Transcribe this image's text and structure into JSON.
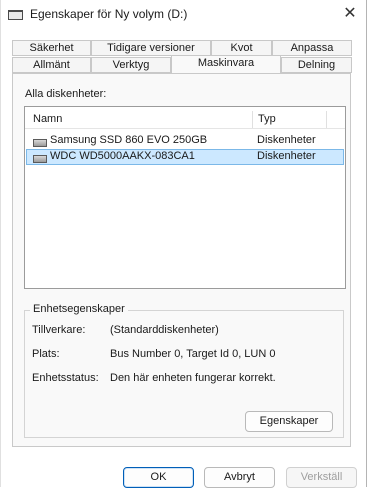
{
  "window": {
    "title": "Egenskaper för Ny volym (D:)"
  },
  "tabs_back": [
    {
      "label": "Säkerhet"
    },
    {
      "label": "Tidigare versioner"
    },
    {
      "label": "Kvot"
    },
    {
      "label": "Anpassa"
    }
  ],
  "tabs_front": [
    {
      "label": "Allmänt"
    },
    {
      "label": "Verktyg"
    },
    {
      "label": "Maskinvara"
    },
    {
      "label": "Delning"
    }
  ],
  "active_tab": "Maskinvara",
  "disks": {
    "label": "Alla diskenheter:",
    "columns": {
      "name": "Namn",
      "type": "Typ"
    },
    "rows": [
      {
        "name": "Samsung SSD 860 EVO 250GB",
        "type": "Diskenheter",
        "selected": false
      },
      {
        "name": "WDC WD5000AAKX-083CA1",
        "type": "Diskenheter",
        "selected": true
      }
    ]
  },
  "properties": {
    "group_title": "Enhetsegenskaper",
    "manufacturer_label": "Tillverkare:",
    "manufacturer_value": "(Standarddiskenheter)",
    "location_label": "Plats:",
    "location_value": "Bus Number 0, Target Id 0, LUN 0",
    "status_label": "Enhetsstatus:",
    "status_value": "Den här enheten fungerar korrekt.",
    "properties_button": "Egenskaper"
  },
  "footer": {
    "ok": "OK",
    "cancel": "Avbryt",
    "apply": "Verkställ"
  }
}
